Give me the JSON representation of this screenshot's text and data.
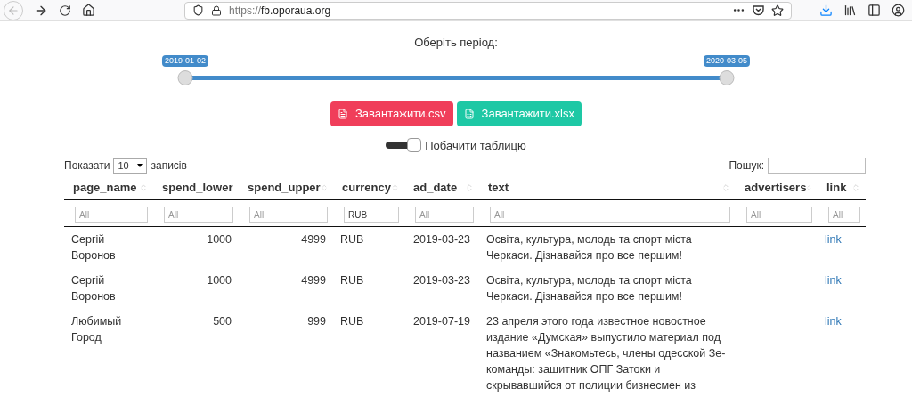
{
  "browser": {
    "back_disabled": true,
    "url": {
      "scheme": "https://",
      "host": "fb.oporaua.org"
    }
  },
  "period": {
    "label": "Оберіть період:",
    "thumbs": [
      {
        "label": "2019-01-02",
        "level": 0
      },
      {
        "label": "2020-03-05",
        "level": 1
      }
    ]
  },
  "downloads": [
    {
      "kind": "csv",
      "label": "Завантажити.csv"
    },
    {
      "kind": "xlsx",
      "label": "Завантажити.xlsx"
    }
  ],
  "table_toggle": {
    "label": "Побачити таблицю",
    "on": true
  },
  "length": {
    "before": "Показати",
    "value": "10",
    "after": "записів"
  },
  "search": {
    "label": "Пошук:"
  },
  "table": {
    "columns": [
      {
        "label": "page_name"
      },
      {
        "label": "spend_lower"
      },
      {
        "label": "spend_upper"
      },
      {
        "label": "currency"
      },
      {
        "label": "ad_date"
      },
      {
        "label": "text"
      },
      {
        "label": "advertisers"
      },
      {
        "label": "link"
      }
    ],
    "filters": [
      {
        "placeholder": "All"
      },
      {
        "placeholder": "All"
      },
      {
        "placeholder": "All"
      },
      {
        "value": "RUB"
      },
      {
        "placeholder": "All"
      },
      {
        "placeholder": "All"
      },
      {
        "placeholder": "All"
      },
      {
        "placeholder": "All"
      }
    ],
    "rows": [
      [
        "Сергій Воронов",
        "1000",
        "4999",
        "RUB",
        "2019-03-23",
        "Освіта, культура, молодь та спорт міста Черкаси. Дізнавайся про все першим!",
        "",
        "link"
      ],
      [
        "Сергій Воронов",
        "1000",
        "4999",
        "RUB",
        "2019-03-23",
        "Освіта, культура, молодь та спорт міста Черкаси. Дізнавайся про все першим!",
        "",
        "link"
      ],
      [
        "Любимый Город",
        "500",
        "999",
        "RUB",
        "2019-07-19",
        "23 апреля этого года известное новостное издание «Думская» выпустило материал под названием «Знакомьтесь, члены одесской Зе-команды: защитник ОПГ Затоки и скрывавшийся от полиции бизнесмен из",
        "",
        "link"
      ]
    ]
  }
}
